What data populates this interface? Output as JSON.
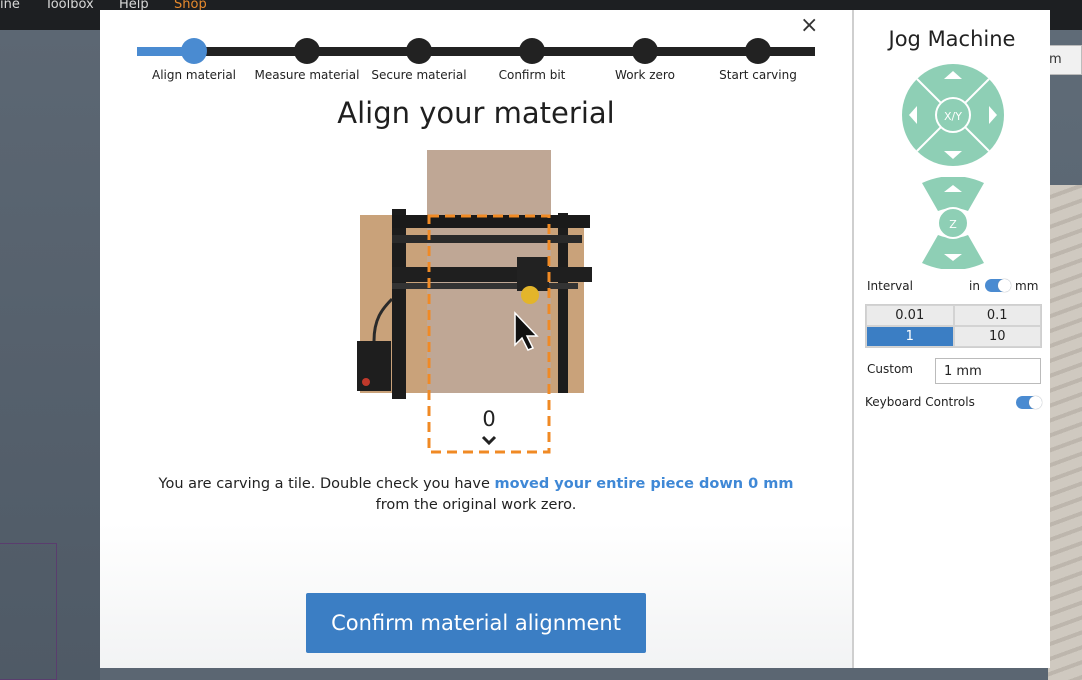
{
  "background_app": {
    "menu": [
      "ine",
      "Toolbox",
      "Help",
      "Shop"
    ],
    "side_tab": "m"
  },
  "dialog": {
    "close_glyph": "×",
    "steps": [
      {
        "label": "Align material",
        "active": true
      },
      {
        "label": "Measure material",
        "active": false
      },
      {
        "label": "Secure material",
        "active": false
      },
      {
        "label": "Confirm bit",
        "active": false
      },
      {
        "label": "Work zero",
        "active": false
      },
      {
        "label": "Start carving",
        "active": false
      }
    ],
    "heading": "Align your material",
    "offset_value": "0",
    "description_pre": "You are carving a tile. Double check you have ",
    "description_highlight": "moved your entire piece down 0 mm",
    "description_post": " from the original work zero.",
    "confirm_button": "Confirm material alignment"
  },
  "jog": {
    "title": "Jog Machine",
    "xy_label": "X/Y",
    "z_label": "Z",
    "interval_label": "Interval",
    "unit_left": "in",
    "unit_right": "mm",
    "unit_selected": "mm",
    "intervals": [
      {
        "value": "0.01",
        "selected": false
      },
      {
        "value": "0.1",
        "selected": false
      },
      {
        "value": "1",
        "selected": true
      },
      {
        "value": "10",
        "selected": false
      }
    ],
    "custom_label": "Custom",
    "custom_value": "1 mm",
    "keyboard_label": "Keyboard Controls",
    "keyboard_enabled": true
  },
  "colors": {
    "accent": "#4a8bd1",
    "button": "#3b7ec4",
    "jog_green": "#8ecfb5",
    "guide_orange": "#f08a24"
  }
}
